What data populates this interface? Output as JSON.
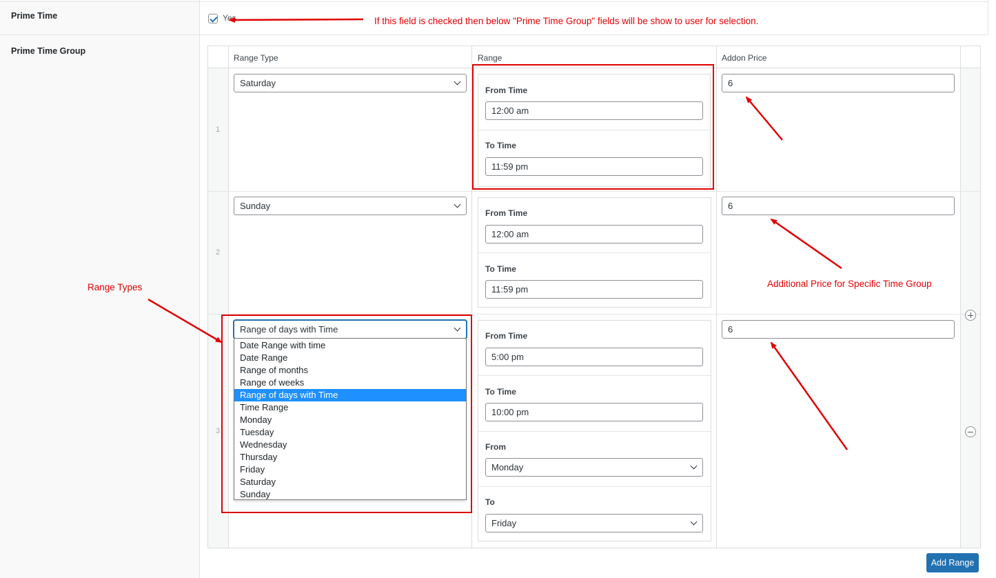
{
  "prime_time": {
    "label": "Prime Time",
    "checkbox_checked": true,
    "checkbox_label": "Yes"
  },
  "prime_time_group": {
    "label": "Prime Time Group",
    "columns": [
      "Range Type",
      "Range",
      "Addon Price"
    ],
    "rows": [
      {
        "index": "1",
        "range_type": "Saturday",
        "from_time_label": "From Time",
        "from_time": "12:00 am",
        "to_time_label": "To Time",
        "to_time": "11:59 pm",
        "addon_price": "6"
      },
      {
        "index": "2",
        "range_type": "Sunday",
        "from_time_label": "From Time",
        "from_time": "12:00 am",
        "to_time_label": "To Time",
        "to_time": "11:59 pm",
        "addon_price": "6"
      },
      {
        "index": "3",
        "range_type": "Range of days with Time",
        "from_time_label": "From Time",
        "from_time": "5:00 pm",
        "to_time_label": "To Time",
        "to_time": "10:00 pm",
        "from_day_label": "From",
        "from_day": "Monday",
        "to_day_label": "To",
        "to_day": "Friday",
        "addon_price": "6"
      }
    ],
    "dropdown_options": [
      "Date Range with time",
      "Date Range",
      "Range of months",
      "Range of weeks",
      "Range of days with Time",
      "Time Range",
      "Monday",
      "Tuesday",
      "Wednesday",
      "Thursday",
      "Friday",
      "Saturday",
      "Sunday"
    ],
    "dropdown_selected": "Range of days with Time",
    "add_range_label": "Add Range"
  },
  "annotations": {
    "checkbox_note": "If this field is checked then below \"Prime Time Group\" fields will be show to user for selection.",
    "range_types_note": "Range Types",
    "price_note": "Additional Price for Specific Time Group"
  },
  "colors": {
    "annotation_red": "#e00000",
    "primary_blue": "#2271b1",
    "selected_option": "#1e90ff"
  }
}
